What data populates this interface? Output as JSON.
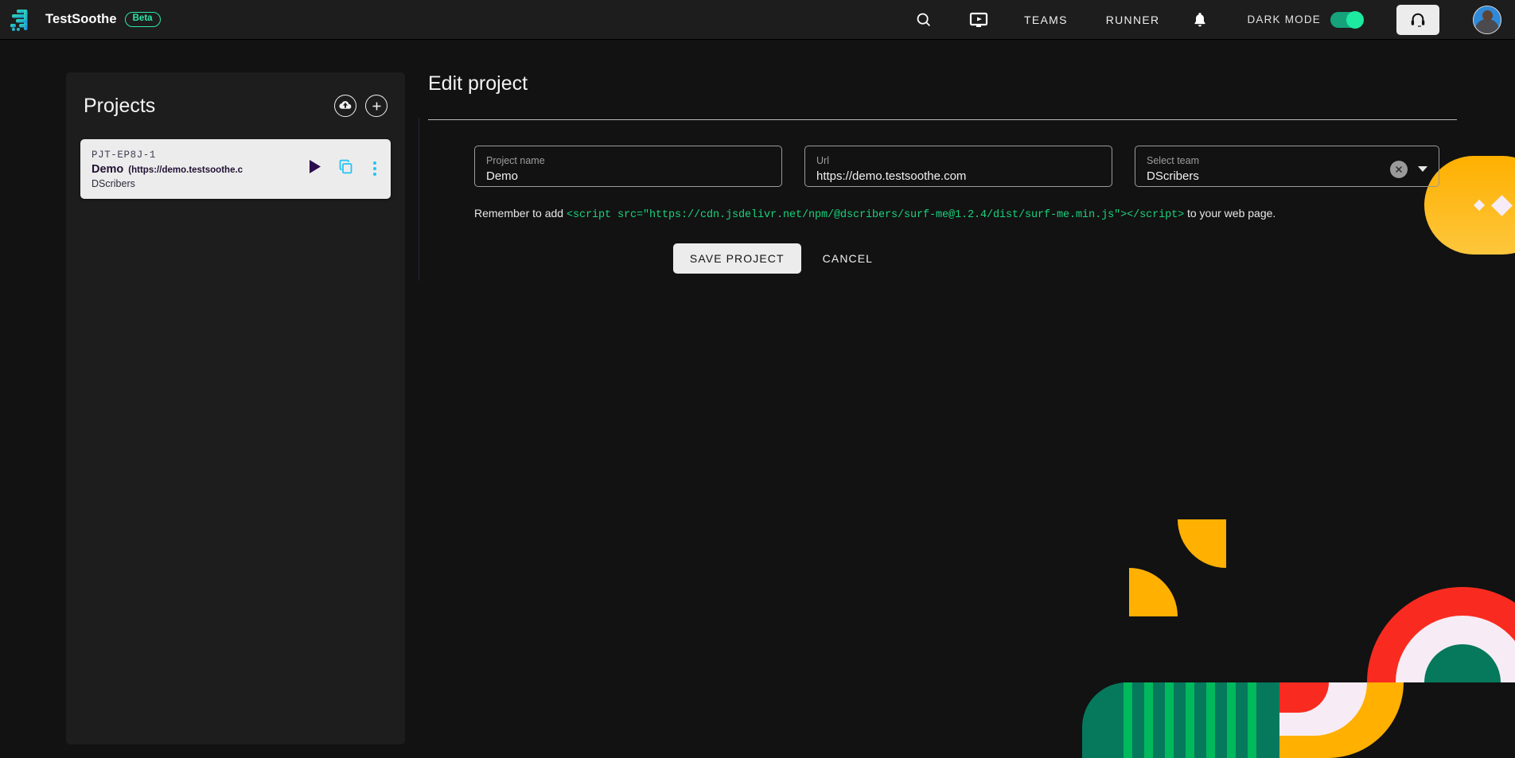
{
  "app": {
    "brand_name": "TestSoothe",
    "beta_label": "Beta",
    "logo_icon": "testsoothe-logo-icon"
  },
  "topbar": {
    "search_icon": "search-icon",
    "runner_video_icon": "video-player-icon",
    "links": [
      {
        "label": "TEAMS"
      },
      {
        "label": "RUNNER"
      }
    ],
    "notifications_icon": "bell-icon",
    "dark_mode_label": "DARK MODE",
    "dark_mode_on": true,
    "support_icon": "headset-icon",
    "avatar_icon": "user-avatar"
  },
  "sidebar": {
    "title": "Projects",
    "upload_icon": "cloud-upload-icon",
    "add_icon": "plus-icon",
    "projects": [
      {
        "code": "PJT-EP8J-1",
        "name": "Demo",
        "url": "(https://demo.testsoothe.c",
        "team": "DScribers",
        "run_icon": "play-icon",
        "copy_icon": "copy-icon",
        "more_icon": "more-vertical-icon"
      }
    ]
  },
  "main": {
    "title": "Edit project",
    "fields": {
      "project_name": {
        "label": "Project name",
        "value": "Demo",
        "placeholder": "Project name"
      },
      "url": {
        "label": "Url",
        "value": "https://demo.testsoothe.com",
        "placeholder": "Url"
      },
      "team": {
        "label": "Select team",
        "value": "DScribers",
        "placeholder": "Select team",
        "clear_icon": "clear-circle-icon",
        "dropdown_icon": "chevron-down-icon"
      }
    },
    "hint": {
      "prefix": "Remember to add ",
      "code": "<script src=\"https://cdn.jsdelivr.net/npm/@dscribers/surf-me@1.2.4/dist/surf-me.min.js\"></script>",
      "suffix": " to your web page."
    },
    "buttons": {
      "save": "SAVE PROJECT",
      "cancel": "CANCEL"
    }
  },
  "colors": {
    "accent_green": "#2ee6a8",
    "accent_cyan": "#20c4f4",
    "toggle_on": "#1de9a0",
    "deco_yellow": "#FFB000",
    "deco_red": "#F92B20",
    "deco_green": "#06785C",
    "deco_bright_green": "#00B95C",
    "deco_cream": "#F7ECF5",
    "code_green": "#1ad17d",
    "page_bg": "#121212",
    "panel_bg": "#1d1d1d"
  }
}
